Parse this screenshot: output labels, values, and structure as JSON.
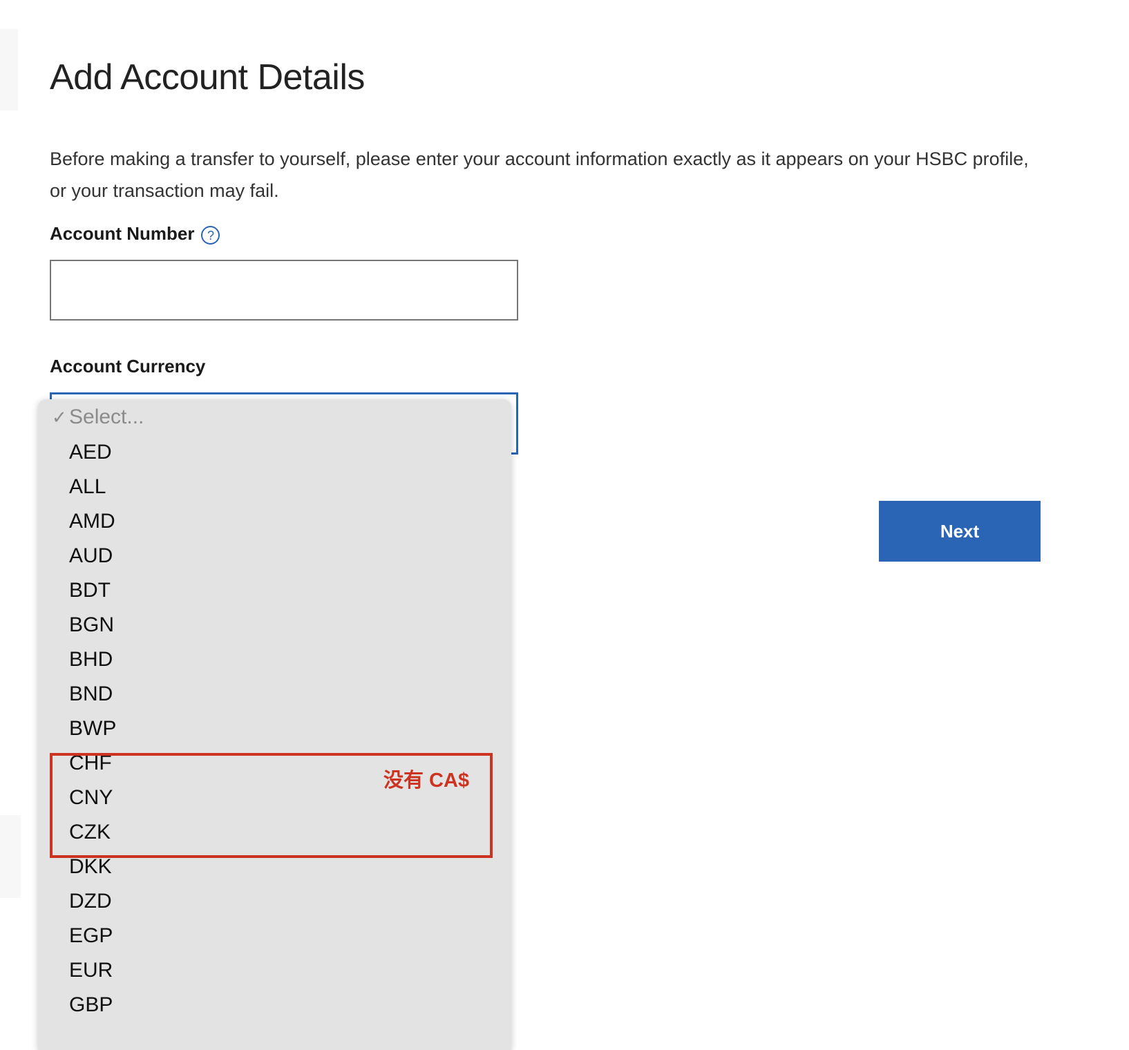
{
  "page": {
    "title": "Add Account Details",
    "intro": "Before making a transfer to yourself, please enter your account information exactly as it appears on your HSBC profile, or your transaction may fail."
  },
  "form": {
    "account_number": {
      "label": "Account Number",
      "value": "",
      "placeholder": "",
      "help_icon": "question-mark-circle-icon",
      "help_glyph": "?"
    },
    "account_currency": {
      "label": "Account Currency",
      "selected_value": "",
      "dropdown_open": true,
      "check_glyph": "✓",
      "options": [
        "Select...",
        "AED",
        "ALL",
        "AMD",
        "AUD",
        "BDT",
        "BGN",
        "BHD",
        "BND",
        "BWP",
        "CHF",
        "CNY",
        "CZK",
        "DKK",
        "DZD",
        "EGP",
        "EUR",
        "GBP"
      ],
      "selected_option_index": 0
    }
  },
  "annotation": {
    "text": "没有 CA$",
    "color": "#cc3321",
    "highlights": [
      "CHF",
      "CNY",
      "CZK"
    ]
  },
  "actions": {
    "next_label": "Next"
  },
  "colors": {
    "accent_blue": "#2a64b5",
    "annotation_red": "#cc3321",
    "dropdown_bg": "#e3e3e3",
    "input_border": "#767676"
  }
}
